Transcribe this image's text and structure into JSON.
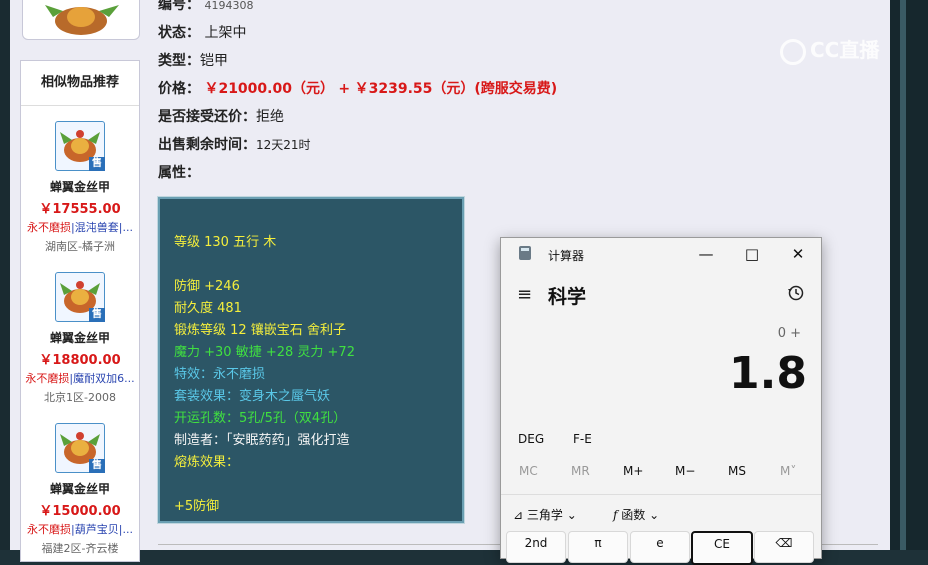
{
  "item": {
    "id_label": "编号：",
    "id_value": "4194308",
    "status_label": "状态：",
    "status_value": "上架中",
    "type_label": "类型：",
    "type_value": "铠甲",
    "price_label": "价格：",
    "price_main": "￥21000.00（元）",
    "price_plus": "+",
    "price_fee": "￥3239.55（元）(跨服交易费)",
    "bargain_label": "是否接受还价：",
    "bargain_value": "拒绝",
    "remaining_label": "出售剩余时间：",
    "remaining_value": "12天21时",
    "attr_label": "属性："
  },
  "attributes": {
    "line1": "等级 130 五行 木",
    "line2": "防御 +246",
    "line3": "耐久度 481",
    "line4": "锻炼等级 12 镶嵌宝石 舍利子",
    "line5": "魔力 +30 敏捷 +28 灵力 +72",
    "line6": "特效：永不磨损",
    "line7": "套装效果：变身木之蜃气妖",
    "line8": "开运孔数：5孔/5孔（双4孔）",
    "line9": "制造者：「安眠药药」强化打造",
    "line10": "熔炼效果：",
    "line11": "+5防御"
  },
  "sidebar": {
    "title": "相似物品推荐",
    "sell_badge": "售",
    "items": [
      {
        "name": "蝉翼金丝甲",
        "price": "￥17555.00",
        "tag1": "永不磨损",
        "tag2": "|混沌兽套|...",
        "region": "湖南区-橘子洲"
      },
      {
        "name": "蝉翼金丝甲",
        "price": "￥18800.00",
        "tag1": "永不磨损",
        "tag2": "|魔耐双加6...",
        "region": "北京1区-2008"
      },
      {
        "name": "蝉翼金丝甲",
        "price": "￥15000.00",
        "tag1": "永不磨损",
        "tag2": "|葫芦宝贝|...",
        "region": "福建2区-齐云楼"
      }
    ]
  },
  "watermark": {
    "text": "CC直播"
  },
  "calculator": {
    "window_title": "计算器",
    "minimize": "—",
    "maximize": "□",
    "close": "✕",
    "mode": "科学",
    "expression": "0 +",
    "display": "1.8",
    "deg": "DEG",
    "fe": "F-E",
    "mem": [
      "MC",
      "MR",
      "M+",
      "M−",
      "MS",
      "M˅"
    ],
    "trig": "三角学",
    "func": "函数",
    "keys": [
      "2nd",
      "π",
      "e",
      "CE",
      "⌫"
    ]
  }
}
